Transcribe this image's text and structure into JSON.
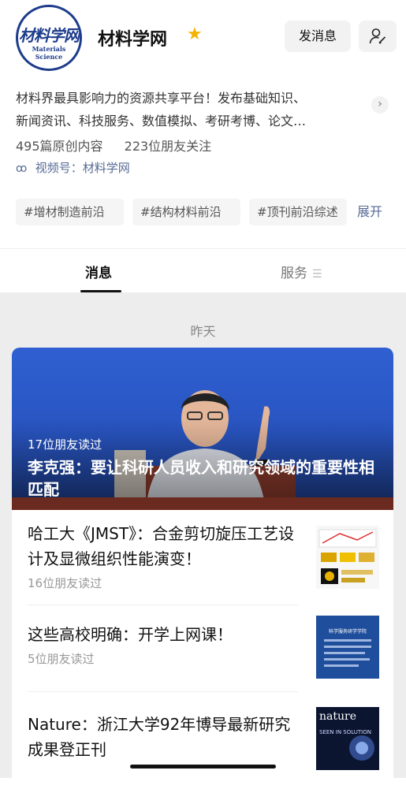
{
  "header": {
    "logo_cn": "材料学网",
    "logo_en": "Materials Science",
    "account_name": "材料学网",
    "send_message_label": "发消息"
  },
  "profile": {
    "description_line1": "材料界最具影响力的资源共享平台！发布基础知识、",
    "description_line2": "新闻资讯、科技服务、数值模拟、考研考博、论文…",
    "original_count": "495篇原创内容",
    "followers": "223位朋友关注",
    "channel": "视频号：材料学网",
    "tags": [
      "#增材制造前沿",
      "#结构材料前沿",
      "#顶刊前沿综述"
    ],
    "expand_label": "展开"
  },
  "tabs": {
    "messages": "消息",
    "services": "服务"
  },
  "feed": {
    "date_label": "昨天",
    "cover": {
      "readers": "17位朋友读过",
      "title": "李克强：要让科研人员收入和研究领域的重要性相匹配"
    },
    "items": [
      {
        "title": "哈工大《JMST》：合金剪切旋压工艺设计及显微组织性能演变！",
        "readers": "16位朋友读过"
      },
      {
        "title": "这些高校明确：开学上网课！",
        "readers": "5位朋友读过"
      },
      {
        "title": "Nature：浙江大学92年博导最新研究成果登正刊",
        "readers": ""
      }
    ],
    "thumb_texts": {
      "notice_title": "科学服务研学学院",
      "nature_logo": "nature",
      "nature_cover_text": "SEEN IN SOLUTION"
    }
  },
  "colors": {
    "link_blue": "#576b95",
    "star": "#f3b300",
    "logo_blue": "#1d3c8c"
  },
  "icons": [
    "star-icon",
    "user-edit-icon",
    "chevron-right-icon",
    "channel-icon",
    "menu-icon"
  ]
}
